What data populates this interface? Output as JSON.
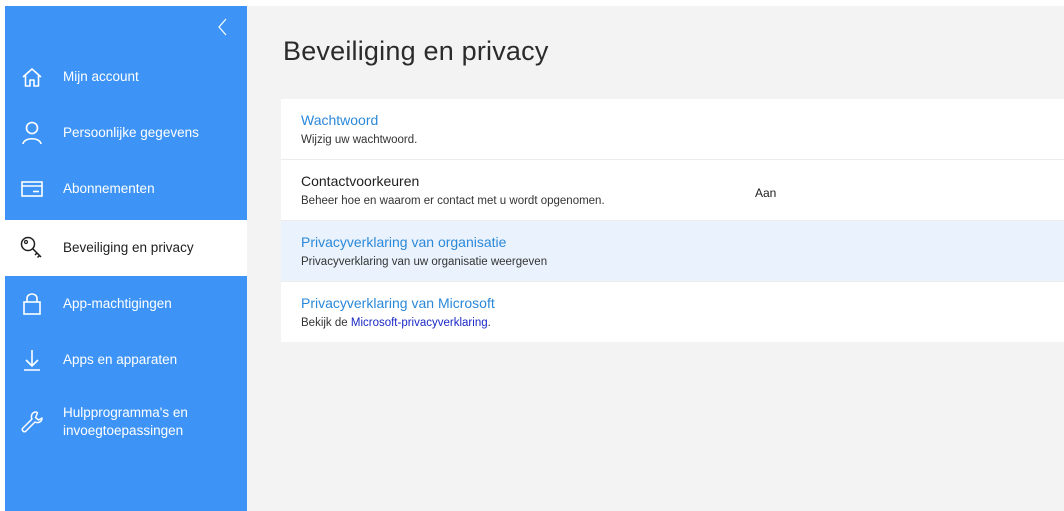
{
  "sidebar": {
    "collapse_icon": "chevron-left-icon",
    "items": [
      {
        "label": "Mijn account",
        "icon": "home-icon"
      },
      {
        "label": "Persoonlijke gegevens",
        "icon": "person-icon"
      },
      {
        "label": "Abonnementen",
        "icon": "card-icon"
      },
      {
        "label": "Beveiliging en privacy",
        "icon": "key-icon",
        "active": true
      },
      {
        "label": "App-machtigingen",
        "icon": "lock-icon"
      },
      {
        "label": "Apps en apparaten",
        "icon": "download-icon"
      },
      {
        "label": "Hulpprogramma's en invoegtoepassingen",
        "icon": "wrench-icon"
      }
    ]
  },
  "main": {
    "title": "Beveiliging en privacy",
    "rows": [
      {
        "title": "Wachtwoord",
        "description": "Wijzig uw wachtwoord."
      },
      {
        "title": "Contactvoorkeuren",
        "description": "Beheer hoe en waarom er contact met u wordt opgenomen.",
        "value": "Aan"
      },
      {
        "title": "Privacyverklaring van organisatie",
        "description": "Privacyverklaring van uw organisatie weergeven"
      },
      {
        "title": "Privacyverklaring van Microsoft",
        "description_prefix": "Bekijk de ",
        "description_link": "Microsoft-privacyverklaring",
        "description_suffix": "."
      }
    ]
  },
  "colors": {
    "sidebar": "#3d94f6",
    "link": "#2b88d8",
    "inline_link": "#1a28c6",
    "highlight_row": "#eaf3fd"
  }
}
